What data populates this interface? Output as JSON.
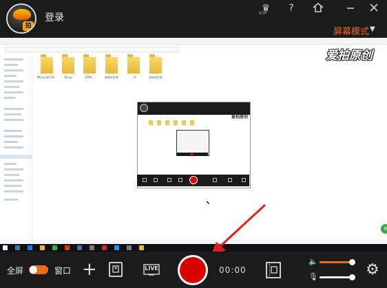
{
  "header": {
    "login_label": "登录",
    "vip_label": "VIP",
    "help_label": "?",
    "mode_label": "屏幕模式",
    "mode_caret": "▼"
  },
  "screen": {
    "watermark": "爱拍原创",
    "nested_watermark": "爱拍原创",
    "folders": [
      {
        "label": "Microsoft Ed..."
      },
      {
        "label": "Biliup"
      },
      {
        "label": "GTAV..."
      },
      {
        "label": "新建文件夹"
      },
      {
        "label": "...R"
      },
      {
        "label": "文档文件夹"
      }
    ],
    "green_badge": "e"
  },
  "controls": {
    "fullscreen_label": "全屏",
    "window_label": "窗口",
    "toggle_state": "fullscreen",
    "live_label": "LIVE",
    "timer": "00:00",
    "volume_level": 0.9,
    "mic_level": 0.9
  },
  "colors": {
    "accent": "#f06a1c",
    "record": "#d80000",
    "background": "#1b1b1b"
  },
  "icons": {
    "vip": "crown-icon",
    "help": "question-icon",
    "home": "home-icon",
    "minimize": "minimize-icon",
    "close": "close-icon",
    "add": "plus-icon",
    "screenshot": "image-frame-icon",
    "live": "live-icon",
    "record": "record-button-icon",
    "video_list": "film-icon",
    "volume": "speaker-icon",
    "mic": "microphone-icon",
    "settings": "gear-icon"
  }
}
